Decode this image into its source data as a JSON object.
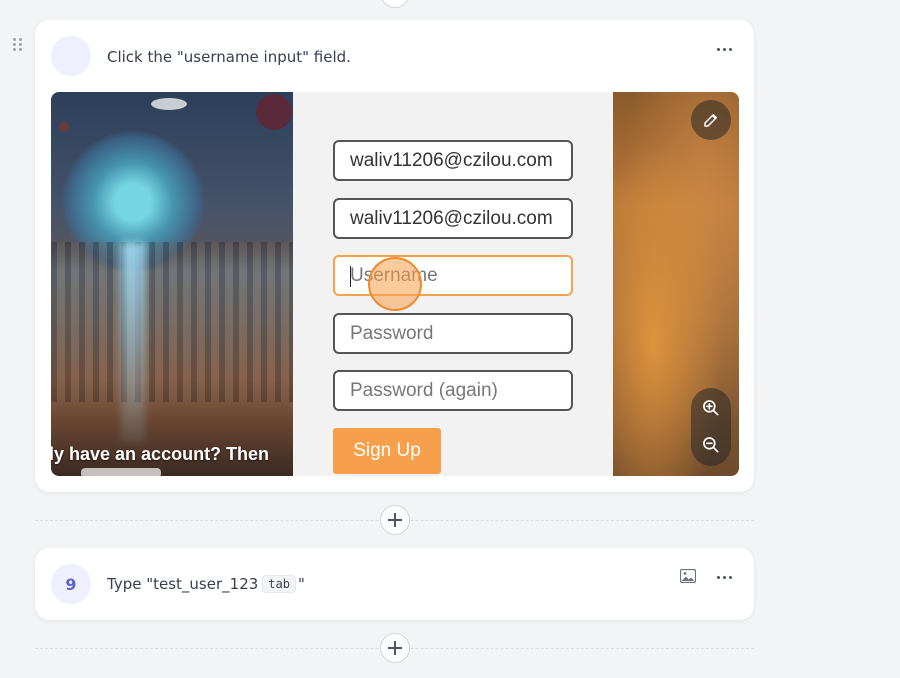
{
  "steps": [
    {
      "number": "",
      "instruction": "Click the \"username input\" field.",
      "screenshot": {
        "caption": "ly have an account? Then",
        "fields": [
          {
            "value": "waliv11206@czilou.com",
            "placeholder": ""
          },
          {
            "value": "waliv11206@czilou.com",
            "placeholder": ""
          },
          {
            "value": "",
            "placeholder": "Username"
          },
          {
            "value": "",
            "placeholder": "Password"
          },
          {
            "value": "",
            "placeholder": "Password (again)"
          }
        ],
        "signup_label": "Sign Up"
      }
    },
    {
      "number": "9",
      "instruction_prefix": "Type \"test_user_123",
      "key": "tab",
      "instruction_suffix": "\""
    }
  ],
  "icons": {
    "drag": "drag-handle-icon",
    "more": "more-horizontal-icon",
    "edit": "pencil-icon",
    "zoom_in": "zoom-in-icon",
    "zoom_out": "zoom-out-icon",
    "image": "image-icon",
    "add": "plus-icon"
  },
  "colors": {
    "accent": "#f7a04c",
    "badge_text": "#5b63d3",
    "badge_bg": "#eef1fd"
  }
}
